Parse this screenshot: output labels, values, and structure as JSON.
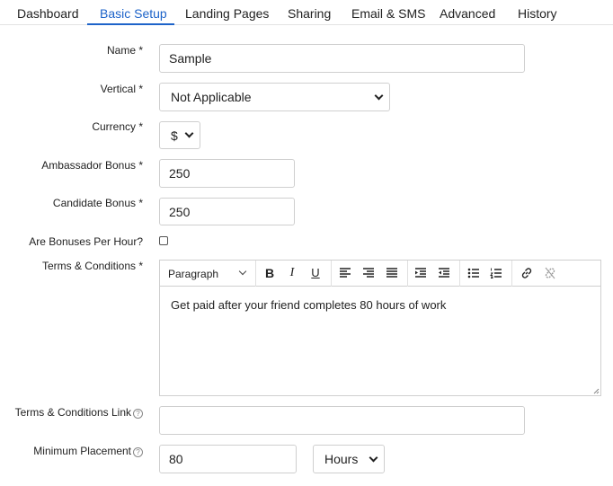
{
  "tabs": [
    {
      "label": "Dashboard"
    },
    {
      "label": "Basic Setup"
    },
    {
      "label": "Landing Pages"
    },
    {
      "label": "Sharing"
    },
    {
      "label": "Email & SMS"
    },
    {
      "label": "Advanced"
    },
    {
      "label": "History"
    }
  ],
  "active_tab": "Basic Setup",
  "accent_color": "#1d63c9",
  "form": {
    "name": {
      "label": "Name *",
      "value": "Sample"
    },
    "vertical": {
      "label": "Vertical *",
      "value": "Not Applicable"
    },
    "currency": {
      "label": "Currency *",
      "value": "$"
    },
    "ambassador_bonus": {
      "label": "Ambassador Bonus *",
      "value": "250"
    },
    "candidate_bonus": {
      "label": "Candidate Bonus *",
      "value": "250"
    },
    "bonuses_per_hour": {
      "label": "Are Bonuses Per Hour?",
      "checked": false
    },
    "terms": {
      "label": "Terms & Conditions *",
      "paragraph_style": "Paragraph",
      "toolbar_icons": [
        "bold-icon",
        "italic-icon",
        "underline-icon",
        "align-left-icon",
        "align-center-icon",
        "align-justify-icon",
        "indent-icon",
        "outdent-icon",
        "bulleted-list-icon",
        "numbered-list-icon",
        "link-icon",
        "unlink-icon"
      ],
      "bold": "B",
      "italic": "I",
      "underline": "U",
      "body": "Get paid after your friend completes 80 hours of work"
    },
    "terms_link": {
      "label": "Terms & Conditions Link",
      "value": ""
    },
    "min_placement": {
      "label": "Minimum Placement",
      "value": "80",
      "unit": "Hours"
    },
    "help_glyph": "?"
  }
}
